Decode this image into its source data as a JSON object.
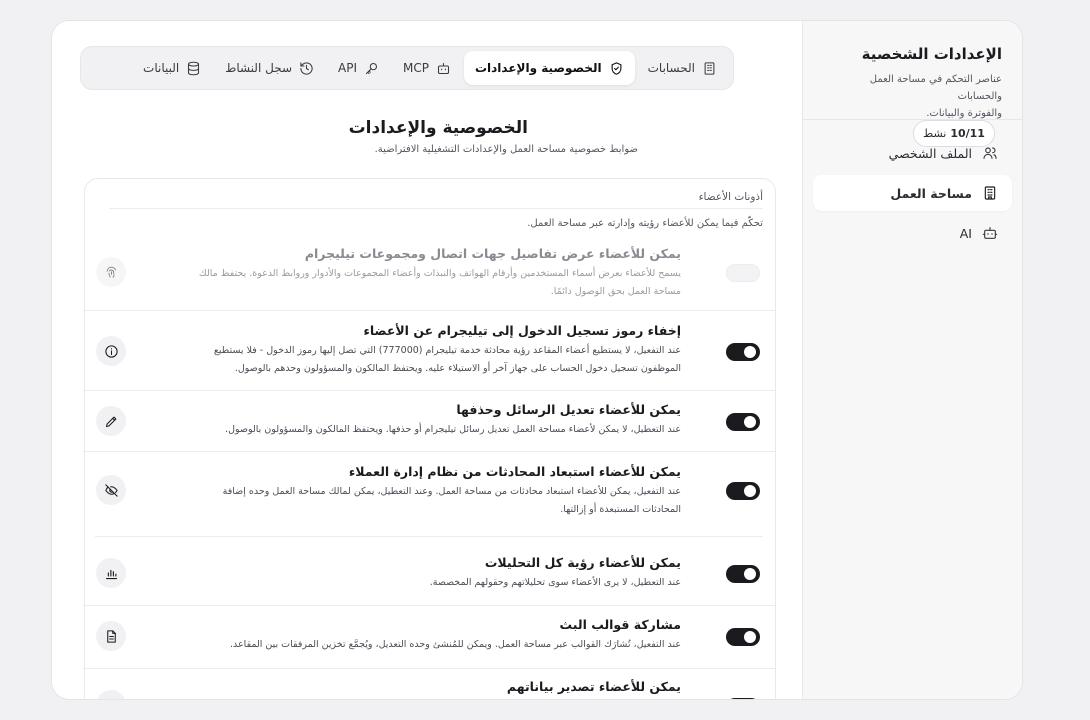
{
  "sidebar": {
    "title": "الإعدادات الشخصية",
    "description_line1": "عناصر التحكم في مساحة العمل والحسابات",
    "description_line2": "والفوترة والبيانات.",
    "items": [
      {
        "label": "الملف الشخصي",
        "icon": "users-icon",
        "active": false
      },
      {
        "label": "مساحة العمل",
        "icon": "building-icon",
        "active": true
      },
      {
        "label": "AI",
        "icon": "bot-icon",
        "active": false
      }
    ]
  },
  "tabs": [
    {
      "label": "الحسابات",
      "icon": "building-icon"
    },
    {
      "label": "الخصوصية والإعدادات",
      "icon": "shield-icon",
      "active": true
    },
    {
      "label": "MCP",
      "icon": "bot-icon"
    },
    {
      "label": "API",
      "icon": "key-icon"
    },
    {
      "label": "سجل النشاط",
      "icon": "history-icon"
    },
    {
      "label": "البيانات",
      "icon": "database-icon"
    }
  ],
  "page": {
    "title": "الخصوصية والإعدادات",
    "subtitle": "ضوابط خصوصية مساحة العمل والإعدادات التشغيلية الافتراضية.",
    "badge_label": "نشط",
    "badge_value": "10/11"
  },
  "card": {
    "title": "أذونات الأعضاء",
    "description": "تحكّم فيما يمكن للأعضاء رؤيته وإدارته عبر مساحة العمل."
  },
  "rows": [
    {
      "title": "يمكن للأعضاء عرض تفاصيل جهات اتصال ومجموعات تيليجرام",
      "desc_line1": "يسمح للأعضاء بعرض أسماء المستخدمين وأرقام الهواتف والنبذات وأعضاء المجموعات والأدوار وروابط الدعوة. يحتفظ مالك",
      "desc_line2": "مساحة العمل بحق الوصول دائمًا.",
      "icon": "fingerprint-icon",
      "enabled": false,
      "disabled": true
    },
    {
      "title": "إخفاء رموز تسجيل الدخول إلى تيليجرام عن الأعضاء",
      "desc_line1": "عند التفعيل، لا يستطيع أعضاء المقاعد رؤية محادثة خدمة تيليجرام (777000) التي تصل إليها رموز الدخول - فلا يستطيع",
      "desc_line2": "الموظفون تسجيل دخول الحساب على جهاز آخر أو الاستيلاء عليه. ويحتفظ المالكون والمسؤولون وحدهم بالوصول.",
      "icon": "info-icon",
      "enabled": true
    },
    {
      "title": "يمكن للأعضاء تعديل الرسائل وحذفها",
      "desc_line1": "عند التعطيل، لا يمكن لأعضاء مساحة العمل تعديل رسائل تيليجرام أو حذفها. ويحتفظ المالكون والمسؤولون بالوصول.",
      "desc_line2": "",
      "icon": "pencil-icon",
      "enabled": true
    },
    {
      "title": "يمكن للأعضاء استبعاد المحادثات من نظام إدارة العملاء",
      "desc_line1": "عند التفعيل، يمكن للأعضاء استبعاد محادثات من مساحة العمل. وعند التعطيل، يمكن لمالك مساحة العمل وحده إضافة",
      "desc_line2": "المحادثات المستبعدة أو إزالتها.",
      "icon": "eye-off-icon",
      "enabled": true
    },
    {
      "title": "يمكن للأعضاء رؤية كل التحليلات",
      "desc_line1": "عند التعطيل، لا يرى الأعضاء سوى تحليلاتهم وحقولهم المخصصة.",
      "desc_line2": "",
      "icon": "bar-chart-icon",
      "enabled": true
    },
    {
      "title": "مشاركة قوالب البث",
      "desc_line1": "عند التفعيل، تُشارَك القوالب عبر مساحة العمل. ويمكن للمُنشئ وحده التعديل، ويُجمَّع تخزين المرفقات بين المقاعد.",
      "desc_line2": "",
      "icon": "file-text-icon",
      "enabled": true
    },
    {
      "title": "يمكن للأعضاء تصدير بياناتهم",
      "desc_line1": "",
      "desc_line2": "",
      "icon": "download-icon",
      "enabled": true
    }
  ]
}
